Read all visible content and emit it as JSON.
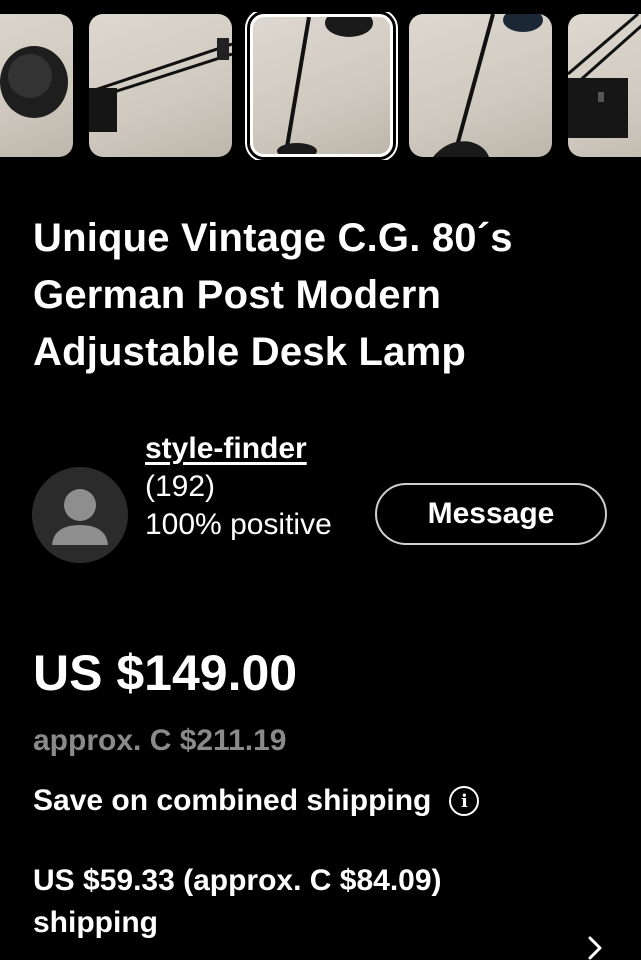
{
  "gallery": {
    "thumbnails": [
      {
        "name": "thumbnail-1",
        "selected": false
      },
      {
        "name": "thumbnail-2",
        "selected": false
      },
      {
        "name": "thumbnail-3",
        "selected": true
      },
      {
        "name": "thumbnail-4",
        "selected": false
      },
      {
        "name": "thumbnail-5",
        "selected": false
      }
    ]
  },
  "listing": {
    "title": "Unique Vintage C.G. 80´s German Post Modern Adjustable Desk Lamp"
  },
  "seller": {
    "avatar_icon": "person-icon",
    "username": "style-finder",
    "rating_count": "(192)",
    "feedback": "100% positive",
    "message_label": "Message"
  },
  "pricing": {
    "price": "US $149.00",
    "approx": "approx. C $211.19",
    "combined_shipping": "Save on combined shipping",
    "info_icon": "info-icon",
    "shipping_line1": "US $59.33 (approx. C $84.09)",
    "shipping_line2": "shipping",
    "chevron_icon": "chevron-right-icon"
  },
  "colors": {
    "background": "#000000",
    "text": "#ffffff",
    "muted": "#8a8a8a",
    "thumb_bg": "#d6d0c7"
  }
}
